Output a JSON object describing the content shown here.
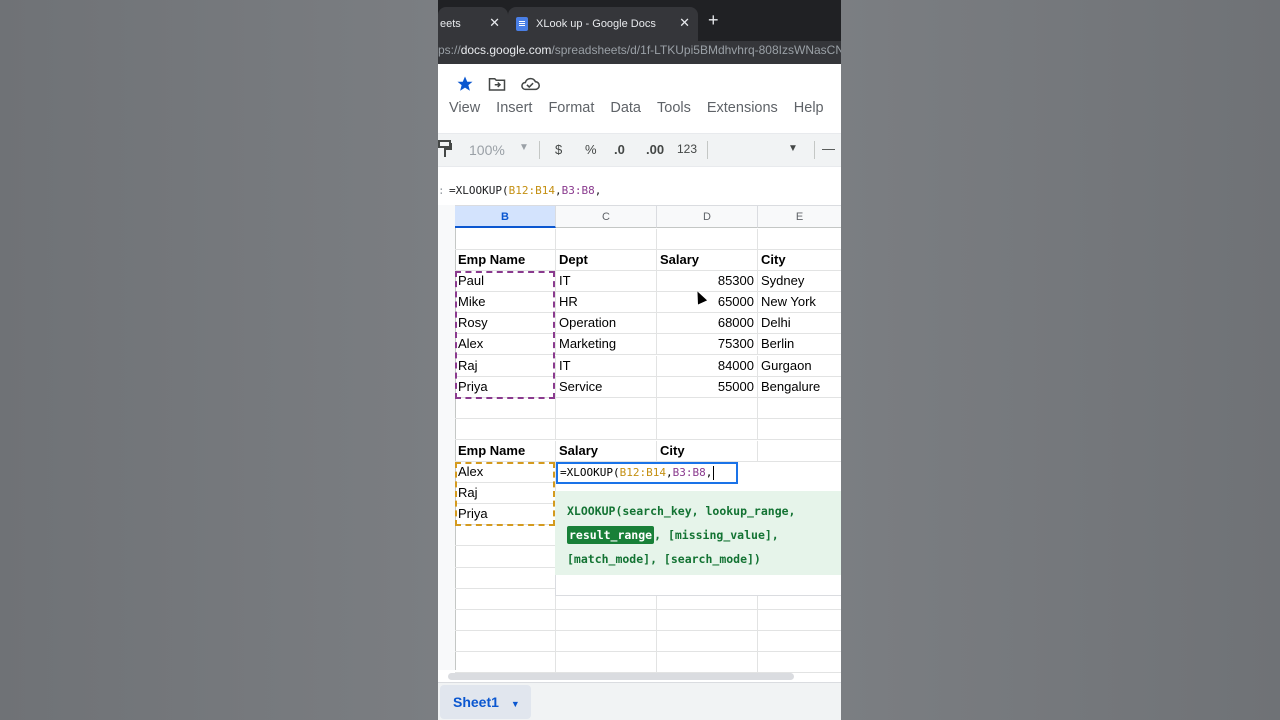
{
  "browser": {
    "tabs": [
      {
        "title": "eets",
        "active": false
      },
      {
        "title": "XLook up - Google Docs",
        "active": true
      }
    ],
    "new_tab": "+",
    "close_glyph": "✕",
    "url_prefix": "ps://",
    "url_host": "docs.google.com",
    "url_path": "/spreadsheets/d/1f-LTKUpi5BMdhvhrq-808IzsWNasCN"
  },
  "menu": [
    "View",
    "Insert",
    "Format",
    "Data",
    "Tools",
    "Extensions",
    "Help"
  ],
  "toolbar": {
    "zoom": "100%",
    "currency": "$",
    "percent": "%",
    "dec_decrease": ".0",
    "dec_increase": ".00",
    "format_more": "123",
    "minus": "—"
  },
  "formula_bar": {
    "prefix": "=XLOOKUP(",
    "arg1": "B12:B14",
    "comma1": ",",
    "arg2": "B3:B8",
    "comma2": ","
  },
  "columns": [
    "B",
    "C",
    "D",
    "E"
  ],
  "table1": {
    "headers": [
      "Emp Name",
      "Dept",
      "Salary",
      "City"
    ],
    "rows": [
      [
        "Paul",
        "IT",
        "85300",
        "Sydney"
      ],
      [
        "Mike",
        "HR",
        "65000",
        "New York"
      ],
      [
        "Rosy",
        "Operation",
        "68000",
        "Delhi"
      ],
      [
        "Alex",
        "Marketing",
        "75300",
        "Berlin"
      ],
      [
        "Raj",
        "IT",
        "84000",
        "Gurgaon"
      ],
      [
        "Priya",
        "Service",
        "55000",
        "Bengalure"
      ]
    ]
  },
  "table2": {
    "headers": [
      "Emp Name",
      "Salary",
      "City"
    ],
    "names": [
      "Alex",
      "Raj",
      "Priya"
    ]
  },
  "active_cell": {
    "prefix": "=XLOOKUP(",
    "arg1": "B12:B14",
    "comma1": ",",
    "arg2": "B3:B8",
    "comma2": ","
  },
  "tooltip": {
    "line1": "XLOOKUP(search_key, lookup_range,",
    "highlight": "result_range",
    "line2_rest": ", [missing_value],",
    "line3": "[match_mode], [search_mode])"
  },
  "sheet_tab": "Sheet1",
  "icons": [
    "star-icon",
    "move-to-folder-icon",
    "cloud-saved-icon",
    "paint-format-icon",
    "chevron-down-icon"
  ]
}
